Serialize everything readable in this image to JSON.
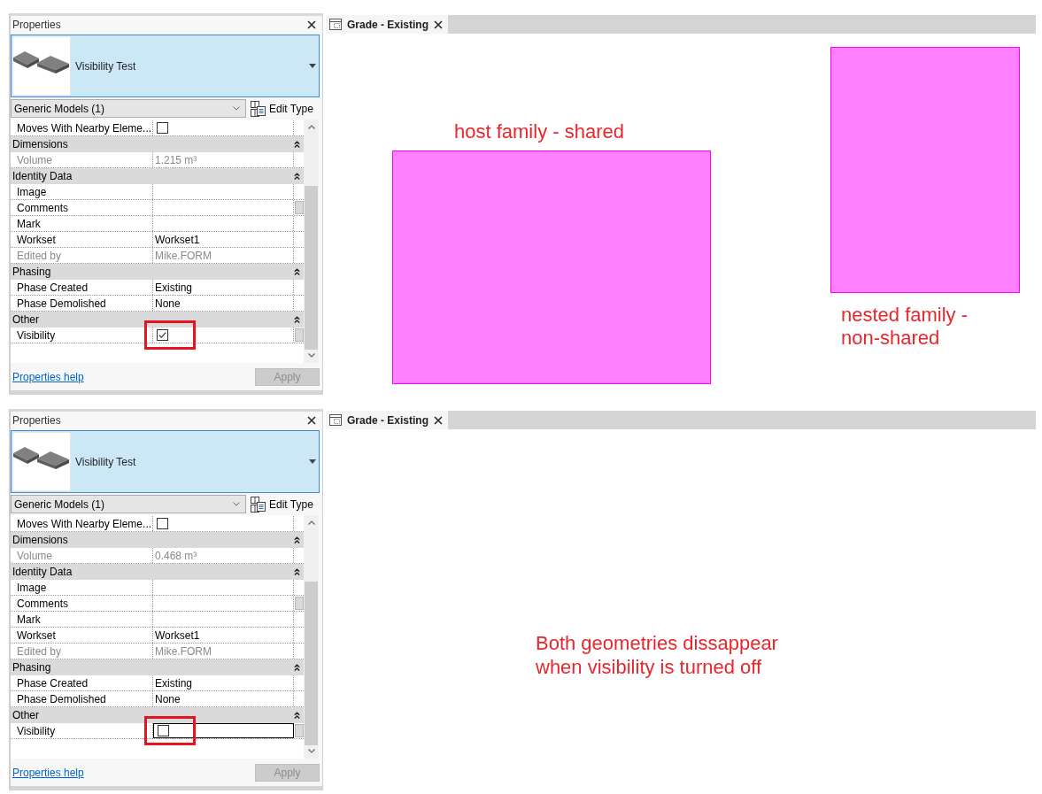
{
  "snapshots": [
    {
      "properties": {
        "title": "Properties",
        "type_selector": {
          "name": "Visibility Test"
        },
        "category_filter": {
          "value": "Generic Models (1)"
        },
        "edit_type": "Edit Type",
        "leading_rows": [
          {
            "kind": "checkbox",
            "label": "Moves With Nearby Eleme...",
            "checked": false,
            "disabled": false,
            "editing": false,
            "highlighted": false,
            "side_button": false
          }
        ],
        "groups": [
          {
            "title": "Dimensions",
            "expanded": true,
            "rows": [
              {
                "kind": "text",
                "label": "Volume",
                "value": "1.215 m³",
                "disabled": true,
                "editing": false,
                "highlighted": false,
                "side_button": false
              }
            ]
          },
          {
            "title": "Identity Data",
            "expanded": true,
            "rows": [
              {
                "kind": "text",
                "label": "Image",
                "disabled": false,
                "editing": false,
                "highlighted": false,
                "side_button": false
              },
              {
                "kind": "text",
                "label": "Comments",
                "disabled": false,
                "editing": false,
                "highlighted": false,
                "side_button": true
              },
              {
                "kind": "text",
                "label": "Mark",
                "disabled": false,
                "editing": false,
                "highlighted": false,
                "side_button": false
              },
              {
                "kind": "text",
                "label": "Workset",
                "value": "Workset1",
                "disabled": false,
                "editing": false,
                "highlighted": false,
                "side_button": false
              },
              {
                "kind": "text",
                "label": "Edited by",
                "value": "Mike.FORM",
                "disabled": true,
                "editing": false,
                "highlighted": false,
                "side_button": false
              }
            ]
          },
          {
            "title": "Phasing",
            "expanded": true,
            "rows": [
              {
                "kind": "text",
                "label": "Phase Created",
                "value": "Existing",
                "disabled": false,
                "editing": false,
                "highlighted": false,
                "side_button": false
              },
              {
                "kind": "text",
                "label": "Phase Demolished",
                "value": "None",
                "disabled": false,
                "editing": false,
                "highlighted": false,
                "side_button": false
              }
            ]
          },
          {
            "title": "Other",
            "expanded": true,
            "rows": [
              {
                "kind": "checkbox",
                "label": "Visibility",
                "checked": true,
                "disabled": false,
                "editing": false,
                "highlighted": true,
                "side_button": true
              }
            ]
          }
        ],
        "help_link": "Properties help",
        "apply_button": {
          "label": "Apply",
          "disabled": true
        }
      },
      "view": {
        "tab": {
          "label": "Grade - Existing",
          "selected": true
        },
        "geometries": [
          {
            "kind": "host",
            "caption": [
              "host family - shared"
            ]
          },
          {
            "kind": "nested",
            "caption": [
              "nested family -",
              "non-shared"
            ]
          }
        ]
      }
    },
    {
      "properties": {
        "title": "Properties",
        "type_selector": {
          "name": "Visibility Test"
        },
        "category_filter": {
          "value": "Generic Models (1)"
        },
        "edit_type": "Edit Type",
        "leading_rows": [
          {
            "kind": "checkbox",
            "label": "Moves With Nearby Eleme...",
            "checked": false,
            "disabled": false,
            "editing": false,
            "highlighted": false,
            "side_button": false
          }
        ],
        "groups": [
          {
            "title": "Dimensions",
            "expanded": true,
            "rows": [
              {
                "kind": "text",
                "label": "Volume",
                "value": "0.468 m³",
                "disabled": true,
                "editing": false,
                "highlighted": false,
                "side_button": false
              }
            ]
          },
          {
            "title": "Identity Data",
            "expanded": true,
            "rows": [
              {
                "kind": "text",
                "label": "Image",
                "disabled": false,
                "editing": false,
                "highlighted": false,
                "side_button": false
              },
              {
                "kind": "text",
                "label": "Comments",
                "disabled": false,
                "editing": false,
                "highlighted": false,
                "side_button": true
              },
              {
                "kind": "text",
                "label": "Mark",
                "disabled": false,
                "editing": false,
                "highlighted": false,
                "side_button": false
              },
              {
                "kind": "text",
                "label": "Workset",
                "value": "Workset1",
                "disabled": false,
                "editing": false,
                "highlighted": false,
                "side_button": false
              },
              {
                "kind": "text",
                "label": "Edited by",
                "value": "Mike.FORM",
                "disabled": true,
                "editing": false,
                "highlighted": false,
                "side_button": false
              }
            ]
          },
          {
            "title": "Phasing",
            "expanded": true,
            "rows": [
              {
                "kind": "text",
                "label": "Phase Created",
                "value": "Existing",
                "disabled": false,
                "editing": false,
                "highlighted": false,
                "side_button": false
              },
              {
                "kind": "text",
                "label": "Phase Demolished",
                "value": "None",
                "disabled": false,
                "editing": false,
                "highlighted": false,
                "side_button": false
              }
            ]
          },
          {
            "title": "Other",
            "expanded": true,
            "rows": [
              {
                "kind": "checkbox",
                "label": "Visibility",
                "checked": false,
                "disabled": false,
                "editing": true,
                "highlighted": true,
                "side_button": true
              }
            ]
          }
        ],
        "help_link": "Properties help",
        "apply_button": {
          "label": "Apply",
          "disabled": true
        }
      },
      "view": {
        "tab": {
          "label": "Grade - Existing",
          "selected": true
        },
        "note": [
          "Both geometries dissappear",
          "when visibility is turned off"
        ]
      }
    }
  ]
}
